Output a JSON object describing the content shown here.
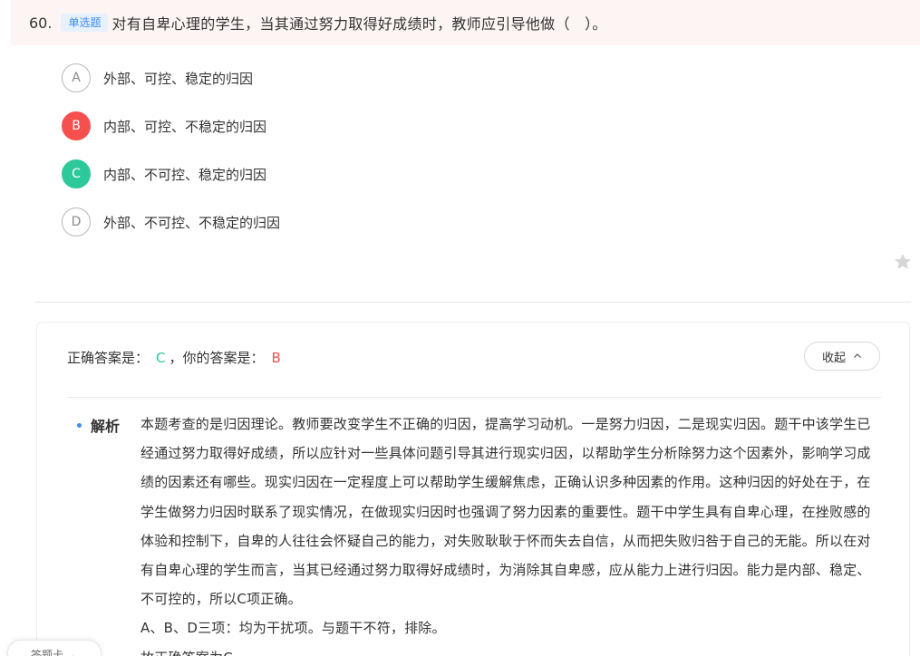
{
  "question": {
    "number": "60.",
    "type_label": "单选题",
    "stem": "对有自卑心理的学生，当其通过努力取得好成绩时，教师应引导他做（　）。"
  },
  "options": [
    {
      "letter": "A",
      "text": "外部、可控、稳定的归因",
      "state": "none"
    },
    {
      "letter": "B",
      "text": "内部、可控、不稳定的归因",
      "state": "wrong"
    },
    {
      "letter": "C",
      "text": "内部、不可控、稳定的归因",
      "state": "correct"
    },
    {
      "letter": "D",
      "text": "外部、不可控、不稳定的归因",
      "state": "none"
    }
  ],
  "favorite_icon": "star-icon",
  "result": {
    "correct_label": "正确答案是：",
    "correct_value": "C",
    "separator": "，",
    "your_label": "你的答案是：",
    "your_value": "B"
  },
  "collapse_button": {
    "label": "收起",
    "icon": "chevron-up-icon"
  },
  "analysis": {
    "label": "解析",
    "paragraphs": [
      "本题考查的是归因理论。教师要改变学生不正确的归因，提高学习动机。一是努力归因，二是现实归因。题干中该学生已经通过努力取得好成绩，所以应针对一些具体问题引导其进行现实归因，以帮助学生分析除努力这个因素外，影响学习成绩的因素还有哪些。现实归因在一定程度上可以帮助学生缓解焦虑，正确认识多种因素的作用。这种归因的好处在于，在学生做努力归因时联系了现实情况，在做现实归因时也强调了努力因素的重要性。题干中学生具有自卑心理，在挫败感的体验和控制下，自卑的人往往会怀疑自己的能力，对失败耿耿于怀而失去自信，从而把失败归咎于自己的无能。所以在对有自卑心理的学生而言，当其已经通过努力取得好成绩时，为消除其自卑感，应从能力上进行归因。能力是内部、稳定、不可控的，所以C项正确。",
      "A、B、D三项：均为干扰项。与题干不符，排除。",
      "故正确答案为C。"
    ]
  },
  "answer_card_tab": {
    "label": "答题卡",
    "icon": "chevron-up-icon"
  },
  "colors": {
    "header_bg": "#fdf5f4",
    "type_badge": "#3d8ef0",
    "wrong": "#f5504e",
    "correct": "#2dc99a"
  }
}
